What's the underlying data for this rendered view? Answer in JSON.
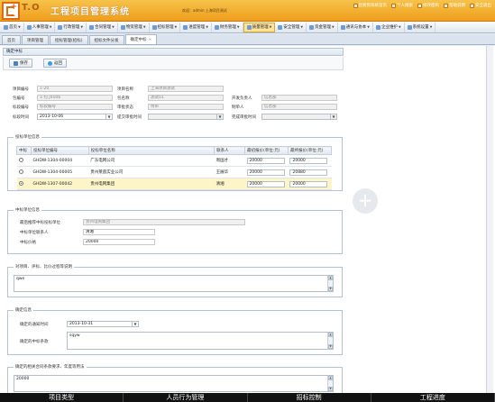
{
  "header": {
    "logo_word": "T.O",
    "app_title": "工程项目管理系统",
    "welcome": "欢迎：admin  上海项目测试",
    "top_links": [
      "您要到系统首页",
      "个人搜索",
      "修改密码",
      "帮助说明",
      "安全退出"
    ]
  },
  "menu": {
    "items": [
      {
        "label": "首页",
        "active": false
      },
      {
        "label": "人事管理",
        "active": false
      },
      {
        "label": "行政管理",
        "active": false
      },
      {
        "label": "合同管理",
        "active": false
      },
      {
        "label": "物资管理",
        "active": false
      },
      {
        "label": "招标管理",
        "active": false
      },
      {
        "label": "进度管理",
        "active": false
      },
      {
        "label": "财务管理",
        "active": false
      },
      {
        "label": "质量管理",
        "active": true
      },
      {
        "label": "安全管理",
        "active": false
      },
      {
        "label": "资金管理",
        "active": false
      },
      {
        "label": "通讯与协本",
        "active": false
      },
      {
        "label": "企业维护",
        "active": false
      },
      {
        "label": "系统设置",
        "active": false
      }
    ]
  },
  "tabs": [
    {
      "label": "首页",
      "active": false
    },
    {
      "label": "项目管理",
      "active": false
    },
    {
      "label": "招标管理(招标)",
      "active": false
    },
    {
      "label": "招标文件分发",
      "active": false
    },
    {
      "label": "确定中标",
      "active": true
    }
  ],
  "panel": {
    "title": "确定中标",
    "save_label": "保存",
    "back_label": "返回"
  },
  "form": {
    "project_code_label": "项目编号",
    "project_code": "1-20",
    "package_code_label": "包编号",
    "package_code": "1-包.J4006",
    "bid_code_label": "标段编号",
    "bid_code": "标段编号",
    "bid_time_label": "标段时间",
    "bid_time": "2013-10-06",
    "project_name_label": "项目名称",
    "project_name": "上海项目测试",
    "package_name_label": "包名称",
    "package_name": "测试01",
    "audit_status_label": "审批状态",
    "audit_status": "待审",
    "submit_time_label": "提交审批时间",
    "submit_time": "",
    "dev_lead_label": "开发负责人",
    "dev_lead": "信息部",
    "creator_label": "制单人",
    "creator": "信息部",
    "done_time_label": "完成审批时间",
    "done_time": ""
  },
  "bidders": {
    "group_title": "投标单位信息",
    "columns": [
      "中标",
      "投标单位编号",
      "投标单位名称",
      "联系人",
      "最初报价(单位:元)",
      "最终报价(单位:元)"
    ],
    "rows": [
      {
        "selected": false,
        "code": "GHDW-1304-00004",
        "name": "广东电网公司",
        "contact": "周国才",
        "initial": "20000",
        "final": "20000"
      },
      {
        "selected": false,
        "code": "GHDW-1304-00005",
        "name": "贵州莱茵实业公司",
        "contact": "王展华",
        "initial": "20000",
        "final": "20880"
      },
      {
        "selected": true,
        "code": "GHDW-1307-00042",
        "name": "贵州电网集团",
        "contact": "清湘",
        "initial": "20000",
        "final": "20000"
      }
    ]
  },
  "winner": {
    "group_title": "中标单位信息",
    "winner_label": "最后推荐中标投标单位",
    "winner_value": "贵州电网集团",
    "contact_label": "中标单位联系人",
    "contact_value": "清湘",
    "price_label": "中标价格",
    "price_value": "20000"
  },
  "review": {
    "group_title": "对项目、评标、比价过程等说明",
    "text": "qwe"
  },
  "confirm": {
    "group_title": "确定信息",
    "time_label": "确定的通知时间",
    "time_value": "2013-10-31",
    "content_label": "确定的中标条款",
    "content_value": "sqyw"
  },
  "contract": {
    "group_title": "确定的相关合同条款要求、年度等用法",
    "text": "20000"
  },
  "bottom_captions": [
    "项目类型",
    "人员行为管理",
    "招标控制",
    "工程进度"
  ]
}
